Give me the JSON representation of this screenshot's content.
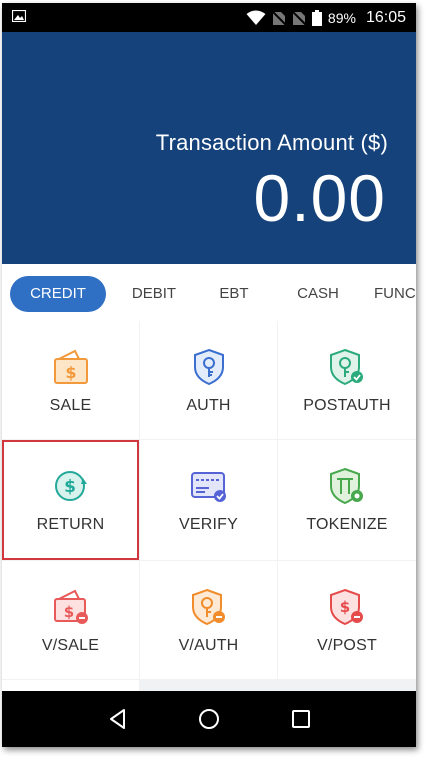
{
  "status_bar": {
    "battery": "89%",
    "time": "16:05"
  },
  "header": {
    "amount_label": "Transaction Amount ($)",
    "amount_value": "0.00"
  },
  "tabs": [
    {
      "label": "CREDIT",
      "active": true
    },
    {
      "label": "DEBIT",
      "active": false
    },
    {
      "label": "EBT",
      "active": false
    },
    {
      "label": "CASH",
      "active": false
    },
    {
      "label": "FUNC",
      "active": false
    }
  ],
  "actions": [
    {
      "label": "SALE",
      "icon": "wallet-dollar-icon",
      "color": "#f29a3b"
    },
    {
      "label": "AUTH",
      "icon": "shield-key-icon",
      "color": "#3a6fd0"
    },
    {
      "label": "POSTAUTH",
      "icon": "shield-key-check-icon",
      "color": "#2bab7c"
    },
    {
      "label": "RETURN",
      "icon": "dollar-return-icon",
      "color": "#22a99a"
    },
    {
      "label": "VERIFY",
      "icon": "card-verify-icon",
      "color": "#5563d6"
    },
    {
      "label": "TOKENIZE",
      "icon": "shield-token-icon",
      "color": "#47a84e"
    },
    {
      "label": "V/SALE",
      "icon": "wallet-dollar-void-icon",
      "color": "#e85a5a"
    },
    {
      "label": "V/AUTH",
      "icon": "shield-key-void-icon",
      "color": "#f08c2b"
    },
    {
      "label": "V/POST",
      "icon": "shield-dollar-void-icon",
      "color": "#e54b4b"
    }
  ],
  "selected_action": "RETURN",
  "colors": {
    "header_bg": "#15427a",
    "tab_active_bg": "#2f6fc4",
    "selection_border": "#d0383e"
  }
}
